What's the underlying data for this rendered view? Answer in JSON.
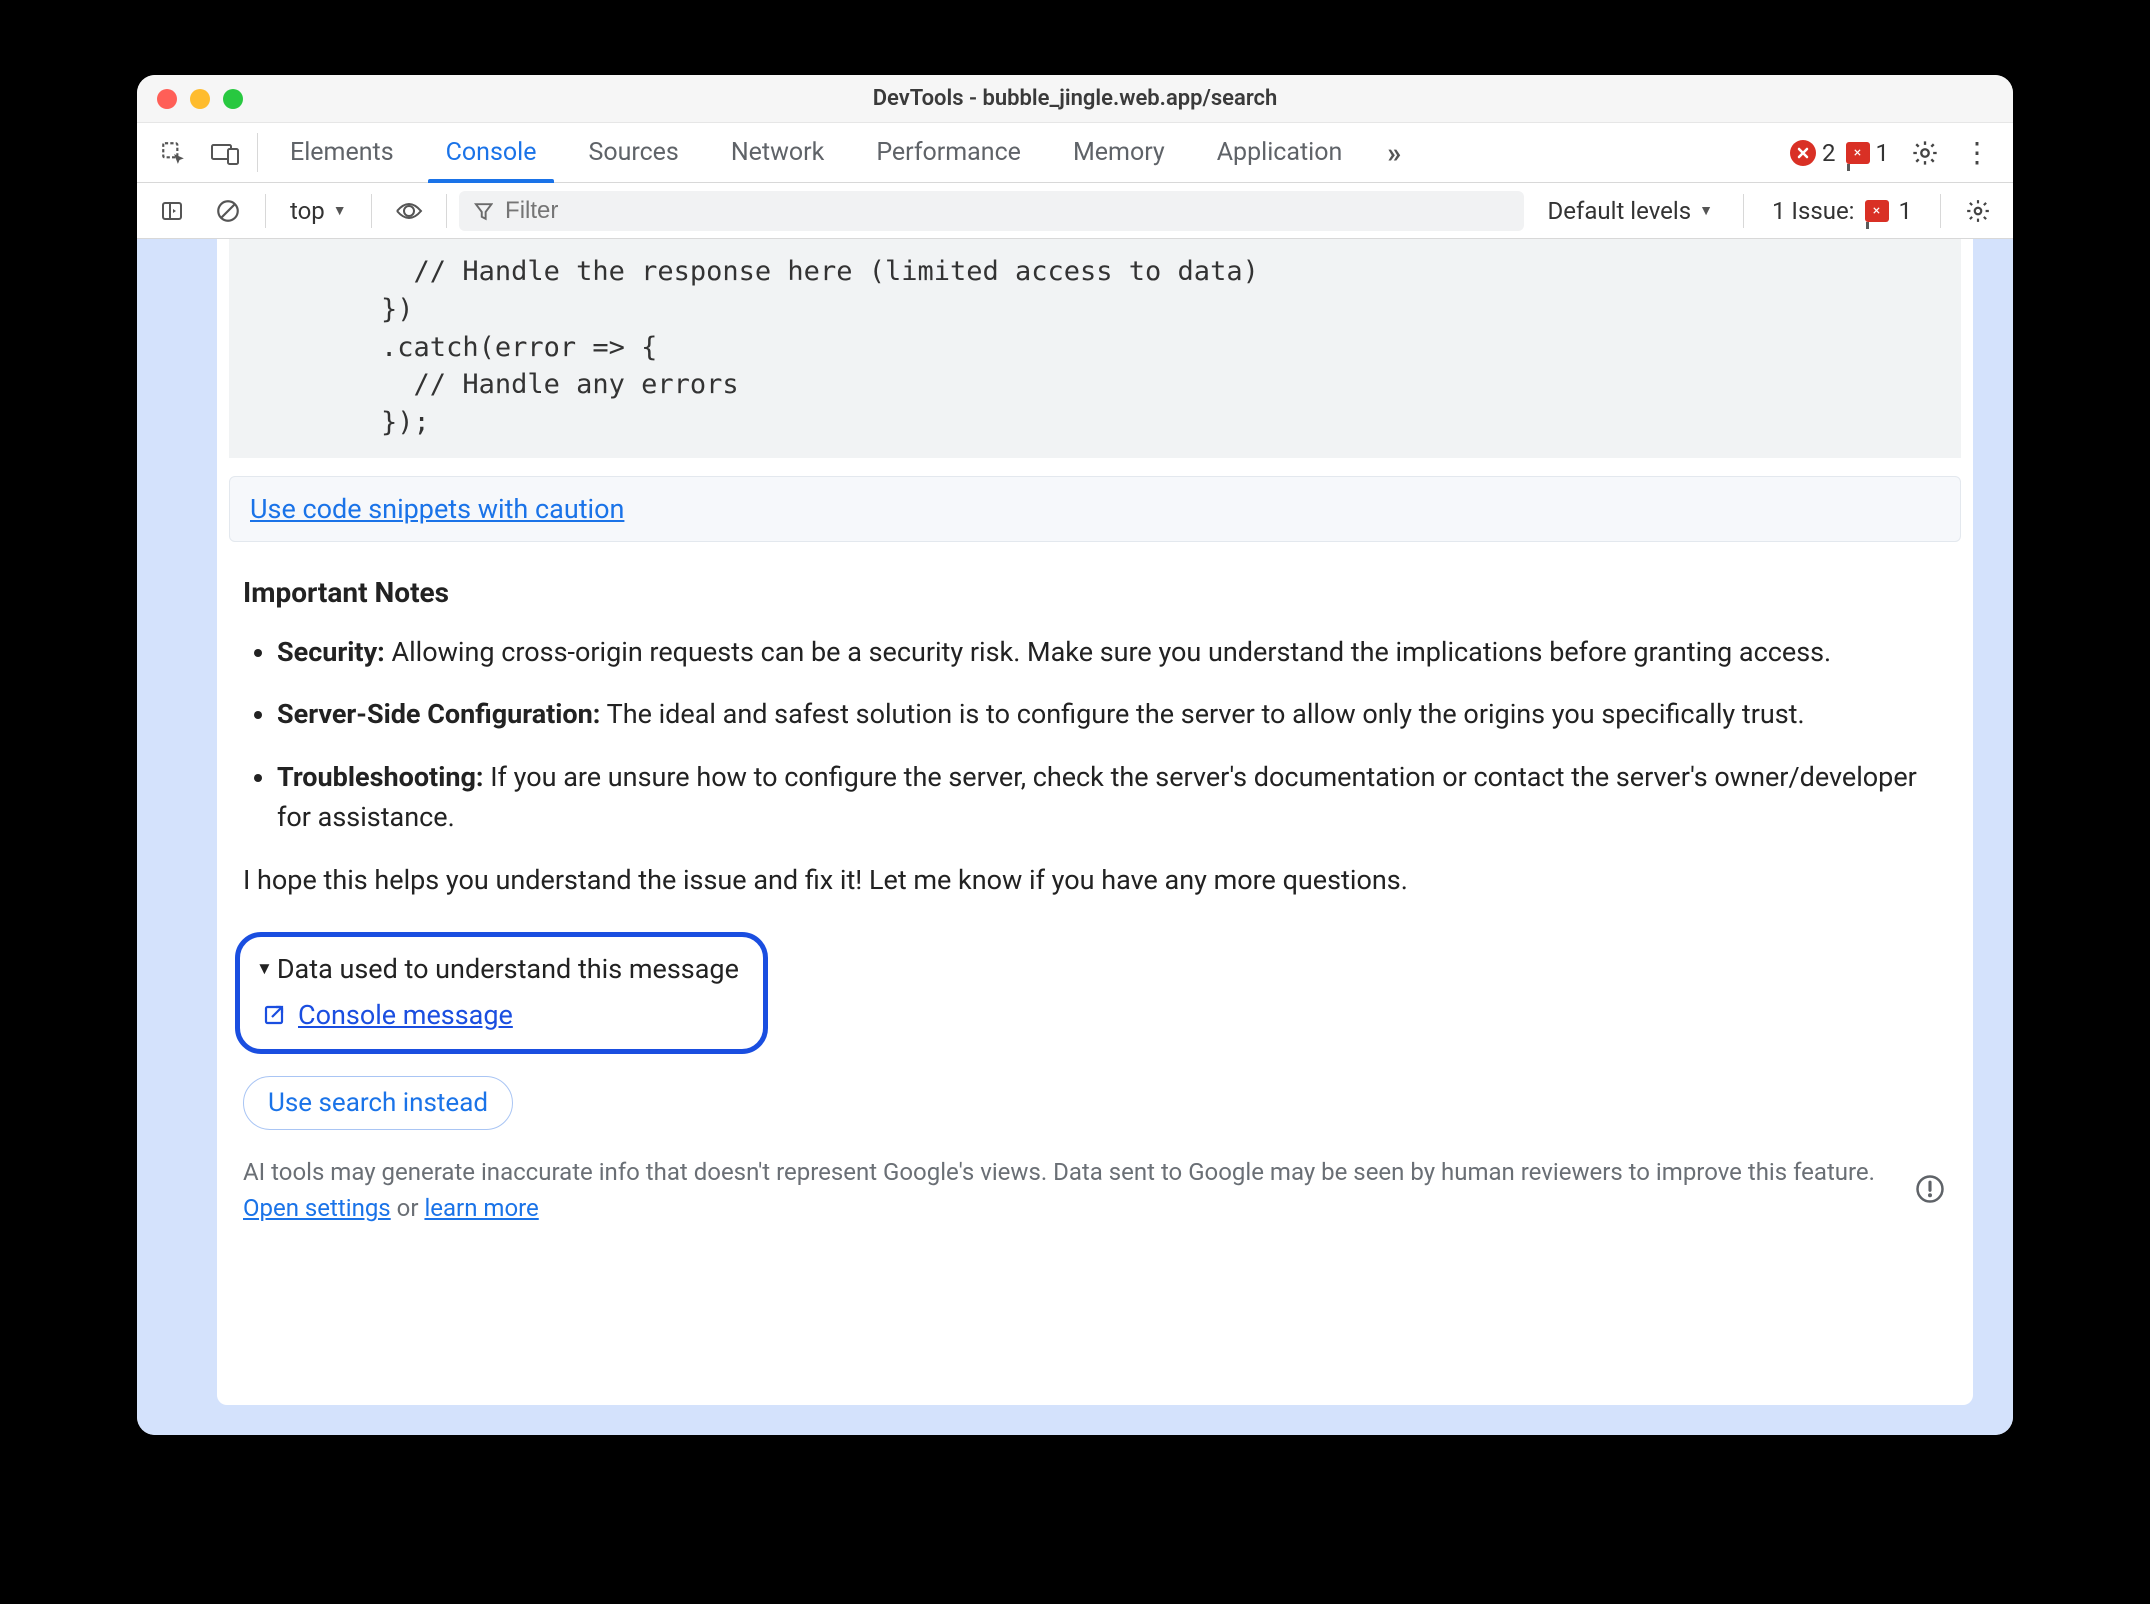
{
  "window": {
    "title": "DevTools - bubble_jingle.web.app/search"
  },
  "tabs": {
    "elements": "Elements",
    "console": "Console",
    "sources": "Sources",
    "network": "Network",
    "performance": "Performance",
    "memory": "Memory",
    "application": "Application"
  },
  "badges": {
    "errors": "2",
    "flag_errors": "1"
  },
  "filterbar": {
    "context": "top",
    "filter_placeholder": "Filter",
    "levels_label": "Default levels",
    "issue_label": "1 Issue:",
    "issue_count": "1"
  },
  "code": "          // Handle the response here (limited access to data)\n        })\n        .catch(error => {\n          // Handle any errors\n        });",
  "snippet_link": "Use code snippets with caution",
  "notes": {
    "heading": "Important Notes",
    "items": [
      {
        "bold": "Security:",
        "text": " Allowing cross-origin requests can be a security risk. Make sure you understand the implications before granting access."
      },
      {
        "bold": "Server-Side Configuration:",
        "text": " The ideal and safest solution is to configure the server to allow only the origins you specifically trust."
      },
      {
        "bold": "Troubleshooting:",
        "text": " If you are unsure how to configure the server, check the server's documentation or contact the server's owner/developer for assistance."
      }
    ],
    "closing": "I hope this helps you understand the issue and fix it! Let me know if you have any more questions."
  },
  "data_ack": {
    "summary": "Data used to understand this message",
    "link": "Console message"
  },
  "search_instead": "Use search instead",
  "disclaimer": {
    "prefix": "AI tools may generate inaccurate info that doesn't represent Google's views. Data sent to Google may be seen by human reviewers to improve this feature. ",
    "open_settings": "Open settings",
    "middle": " or ",
    "learn_more": "learn more"
  }
}
